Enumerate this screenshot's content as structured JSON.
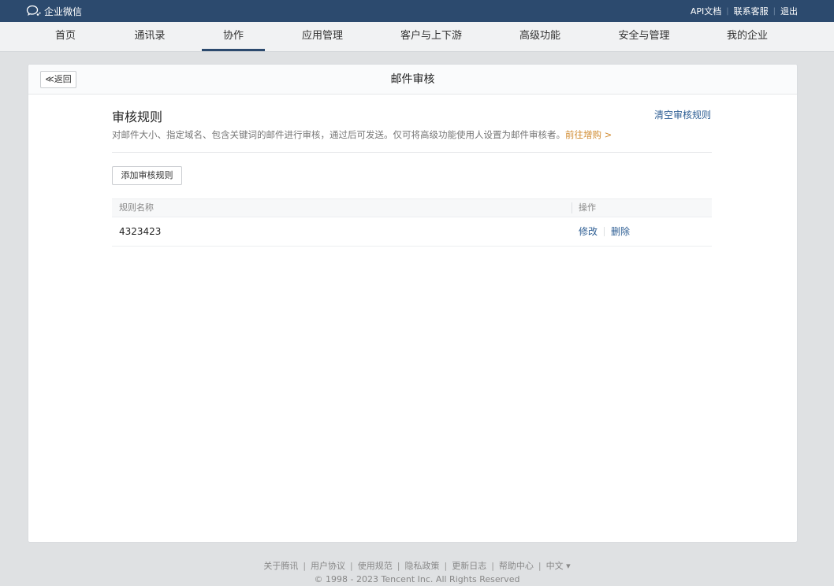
{
  "topbar": {
    "brand": "企业微信",
    "links": [
      "API文档",
      "联系客服",
      "退出"
    ]
  },
  "nav": {
    "items": [
      "首页",
      "通讯录",
      "协作",
      "应用管理",
      "客户与上下游",
      "高级功能",
      "安全与管理",
      "我的企业"
    ],
    "active": "协作"
  },
  "page": {
    "back_label": "≪返回",
    "title": "邮件审核"
  },
  "rules": {
    "section_title": "审核规则",
    "clear_label": "清空审核规则",
    "description": "对邮件大小、指定域名、包含关键词的邮件进行审核，通过后可发送。仅可将高级功能使用人设置为邮件审核者。",
    "upgrade_label": "前往增购 >",
    "add_button": "添加审核规则",
    "table": {
      "headers": [
        "规则名称",
        "操作"
      ],
      "rows": [
        {
          "name": "4323423",
          "ops": [
            "修改",
            "删除"
          ]
        }
      ]
    }
  },
  "footer": {
    "links": [
      "关于腾讯",
      "用户协议",
      "使用规范",
      "隐私政策",
      "更新日志",
      "帮助中心",
      "中文 ▾"
    ],
    "copyright": "© 1998 - 2023 Tencent Inc. All Rights Reserved"
  },
  "colors": {
    "topbar": "#2c4a6e",
    "link": "#2c5d93",
    "upgrade": "#d08a2f"
  }
}
